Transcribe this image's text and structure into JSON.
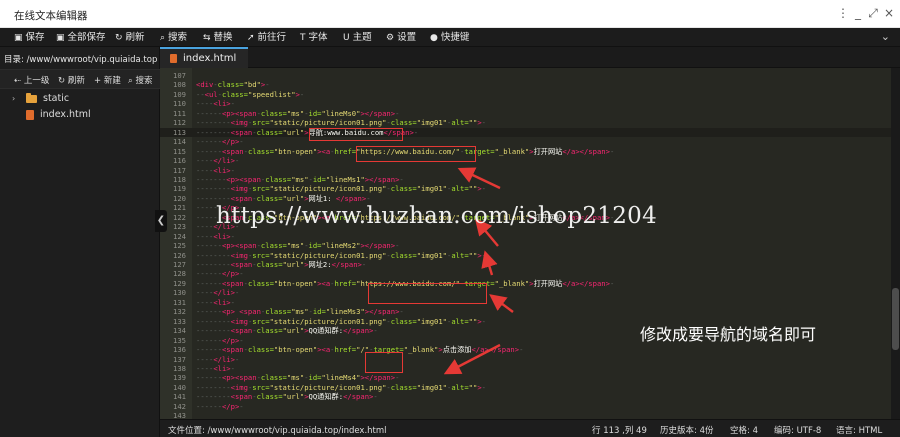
{
  "window": {
    "title": "在线文本编辑器",
    "controls": [
      "⋮",
      "_",
      "⤢",
      "×"
    ]
  },
  "toolbar": {
    "items": [
      {
        "icon": "save-icon",
        "glyph": "▣",
        "label": "保存"
      },
      {
        "icon": "save-all-icon",
        "glyph": "▣",
        "label": "全部保存"
      },
      {
        "icon": "refresh-icon",
        "glyph": "↻",
        "label": "刷新"
      },
      {
        "icon": "search-icon",
        "glyph": "⌕",
        "label": "搜索"
      },
      {
        "icon": "replace-icon",
        "glyph": "⇆",
        "label": "替换"
      },
      {
        "icon": "goto-line-icon",
        "glyph": "➚",
        "label": "前往行"
      },
      {
        "icon": "font-icon",
        "glyph": "T",
        "label": "字体"
      },
      {
        "icon": "theme-icon",
        "glyph": "U",
        "label": "主题"
      },
      {
        "icon": "settings-icon",
        "glyph": "⚙",
        "label": "设置"
      },
      {
        "icon": "shortcut-icon",
        "glyph": "●",
        "label": "快捷键"
      }
    ],
    "collapse_glyph": "⌄"
  },
  "sidebar": {
    "directory": "目录: /www/wwwroot/vip.quiaida.top",
    "actions": [
      {
        "icon": "up-icon",
        "glyph": "⇠",
        "label": "上一级"
      },
      {
        "icon": "refresh-icon",
        "glyph": "↻",
        "label": "刷新"
      },
      {
        "icon": "new-icon",
        "glyph": "+",
        "label": "新建"
      },
      {
        "icon": "search-icon",
        "glyph": "⌕",
        "label": "搜索"
      }
    ],
    "tree": [
      {
        "type": "folder",
        "label": "static"
      },
      {
        "type": "file",
        "label": "index.html"
      }
    ],
    "toggle_glyph": "❮"
  },
  "tabs": [
    {
      "label": "index.html",
      "active": true
    }
  ],
  "editor": {
    "active_line": 113,
    "lines": [
      {
        "n": "107",
        "code": ""
      },
      {
        "n": "108",
        "code": "<div class=\"bd\">"
      },
      {
        "n": "109",
        "code": "  <ul class=\"speedlist\">"
      },
      {
        "n": "110",
        "code": "    <li>"
      },
      {
        "n": "111",
        "code": "      <p><span class=\"ms\" id=\"lineMs0\"></span>"
      },
      {
        "n": "112",
        "code": "        <img src=\"static/picture/icon01.png\" class=\"img01\" alt=\"\">"
      },
      {
        "n": "113",
        "code": "        <span class=\"url\">导航:www.baidu.com</span>"
      },
      {
        "n": "114",
        "code": "      </p>"
      },
      {
        "n": "115",
        "code": "      <span class=\"btn-open\"><a href=\"https://www.baidu.com/\" target=\"_blank\">打开网站</a></span>"
      },
      {
        "n": "116",
        "code": "    </li>"
      },
      {
        "n": "117",
        "code": "    <li>"
      },
      {
        "n": "118",
        "code": "       <p><span class=\"ms\" id=\"lineMs1\"></span>"
      },
      {
        "n": "119",
        "code": "        <img src=\"static/picture/icon01.png\" class=\"img01\" alt=\"\">"
      },
      {
        "n": "120",
        "code": "        <span class=\"url\">网址1: </span>"
      },
      {
        "n": "121",
        "code": "      </p>"
      },
      {
        "n": "122",
        "code": "      <span class=\"btn-open\"><a href=\"https://www.baidu.com/\" target=\"_blank\">打开网站</a></span>"
      },
      {
        "n": "123",
        "code": "    </li>"
      },
      {
        "n": "124",
        "code": "    <li>"
      },
      {
        "n": "125",
        "code": "      <p><span class=\"ms\" id=\"lineMs2\"></span>"
      },
      {
        "n": "126",
        "code": "        <img src=\"static/picture/icon01.png\" class=\"img01\" alt=\"\">"
      },
      {
        "n": "127",
        "code": "        <span class=\"url\">网址2:</span>"
      },
      {
        "n": "128",
        "code": "      </p>"
      },
      {
        "n": "129",
        "code": "      <span class=\"btn-open\"><a href=\"https://www.baidu.com/\" target=\"_blank\">打开网站</a></span>"
      },
      {
        "n": "130",
        "code": "    </li>"
      },
      {
        "n": "131",
        "code": "    <li>"
      },
      {
        "n": "132",
        "code": "      <p> <span class=\"ms\" id=\"lineMs3\"></span>"
      },
      {
        "n": "133",
        "code": "        <img src=\"static/picture/icon01.png\" class=\"img01\" alt=\"\">"
      },
      {
        "n": "134",
        "code": "        <span class=\"url\">QQ通知群:</span>"
      },
      {
        "n": "135",
        "code": "      </p>"
      },
      {
        "n": "136",
        "code": "      <span class=\"btn-open\"><a href=\"/\" target=\"_blank\">点击添加</a></span>"
      },
      {
        "n": "137",
        "code": "    </li>"
      },
      {
        "n": "138",
        "code": "    <li>"
      },
      {
        "n": "139",
        "code": "      <p><span class=\"ms\" id=\"lineMs4\"></span>"
      },
      {
        "n": "140",
        "code": "        <img src=\"static/picture/icon01.png\" class=\"img01\" alt=\"\">"
      },
      {
        "n": "141",
        "code": "        <span class=\"url\">QQ通知群:</span>"
      },
      {
        "n": "142",
        "code": "      </p>"
      },
      {
        "n": "143",
        "code": ""
      }
    ]
  },
  "statusbar": {
    "file_path": "文件位置: /www/wwwroot/vip.quiaida.top/index.html",
    "cursor": "行 113 ,列 49",
    "history": "历史版本: 4份",
    "spaces": "空格: 4",
    "encoding": "编码: UTF-8",
    "language": "语言: HTML"
  },
  "annotations": {
    "callout": "修改成要导航的域名即可",
    "watermark": "https://www.huzhan.com/ishop21204",
    "color": "#e53935"
  }
}
